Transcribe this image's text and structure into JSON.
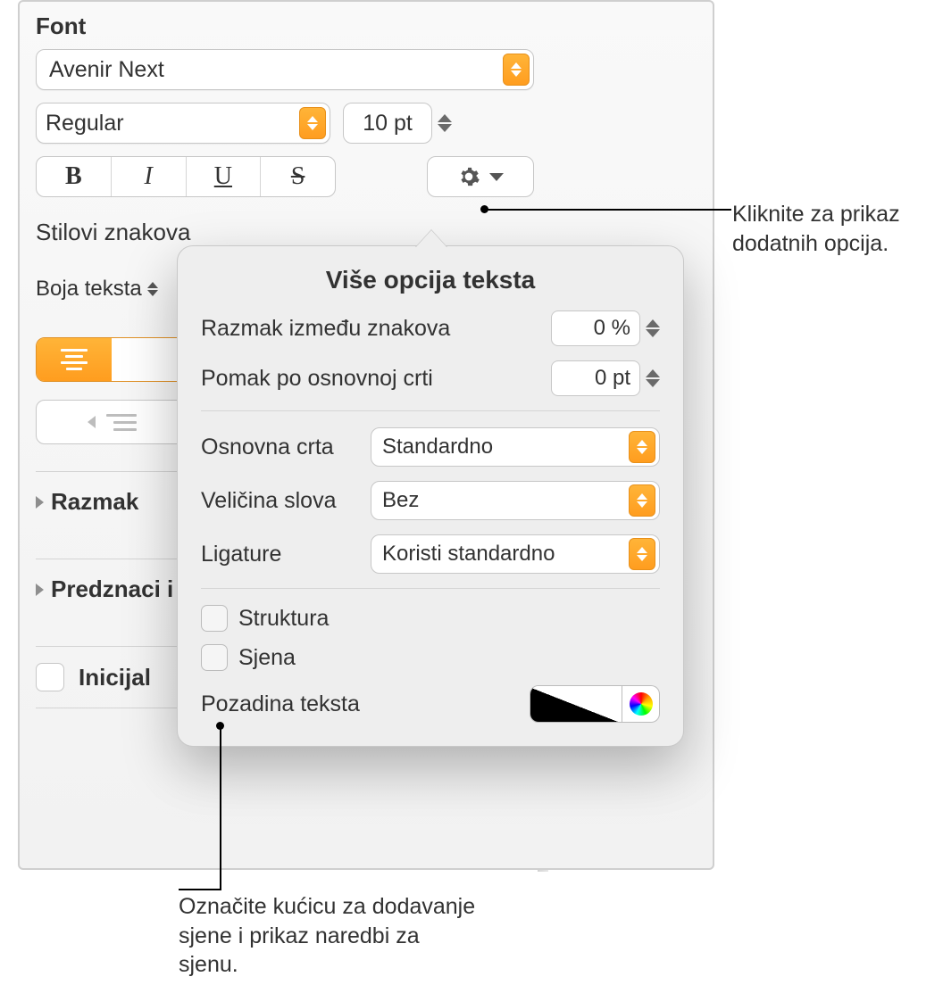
{
  "panel": {
    "font_heading": "Font",
    "font_family": "Avenir Next",
    "font_style": "Regular",
    "font_size": "10 pt",
    "char_styles_label": "Stilovi znakova",
    "text_color_label": "Boja teksta",
    "sections": {
      "spacing": "Razmak",
      "bullets": "Predznaci i",
      "dropcap": "Inicijal"
    }
  },
  "popover": {
    "title": "Više opcija teksta",
    "char_spacing_label": "Razmak između znakova",
    "char_spacing_value": "0 %",
    "baseline_shift_label": "Pomak po osnovnoj crti",
    "baseline_shift_value": "0 pt",
    "baseline_label": "Osnovna crta",
    "baseline_value": "Standardno",
    "caps_label": "Veličina slova",
    "caps_value": "Bez",
    "ligatures_label": "Ligature",
    "ligatures_value": "Koristi standardno",
    "outline_label": "Struktura",
    "shadow_label": "Sjena",
    "text_bg_label": "Pozadina teksta"
  },
  "callouts": {
    "top": "Kliknite za prikaz dodatnih opcija.",
    "bottom": "Označite kućicu za dodavanje sjene i prikaz naredbi za sjenu."
  }
}
